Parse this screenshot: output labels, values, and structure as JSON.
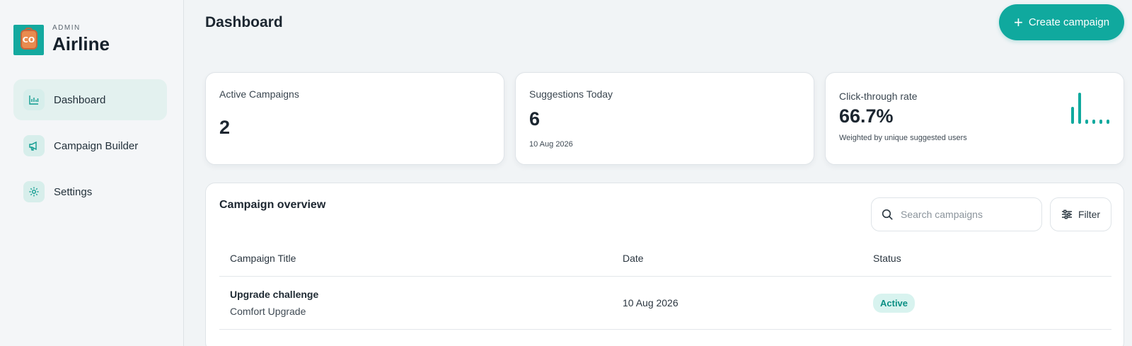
{
  "brand": {
    "kicker": "ADMIN",
    "name": "Airline",
    "logo_text": "CO"
  },
  "sidebar": {
    "items": [
      {
        "label": "Dashboard",
        "icon": "chart-icon",
        "active": true
      },
      {
        "label": "Campaign Builder",
        "icon": "megaphone-icon",
        "active": false
      },
      {
        "label": "Settings",
        "icon": "gear-icon",
        "active": false
      }
    ]
  },
  "header": {
    "title": "Dashboard",
    "create_label": "Create campaign"
  },
  "stats": {
    "active_campaigns": {
      "label": "Active Campaigns",
      "value": "2"
    },
    "suggestions_today": {
      "label": "Suggestions Today",
      "value": "6",
      "sub": "10 Aug 2026"
    },
    "ctr": {
      "label": "Click-through rate",
      "value": "66.7%",
      "sub": "Weighted by unique suggested users"
    }
  },
  "overview": {
    "title": "Campaign overview",
    "search_placeholder": "Search campaigns",
    "filter_label": "Filter",
    "columns": [
      "Campaign Title",
      "Date",
      "Status"
    ],
    "rows": [
      {
        "title": "Upgrade challenge",
        "subtitle": "Comfort Upgrade",
        "date": "10 Aug 2026",
        "status": "Active"
      }
    ]
  },
  "colors": {
    "accent": "#10a99e",
    "badge_bg": "#d8f3ef",
    "badge_text": "#0b8f84"
  }
}
